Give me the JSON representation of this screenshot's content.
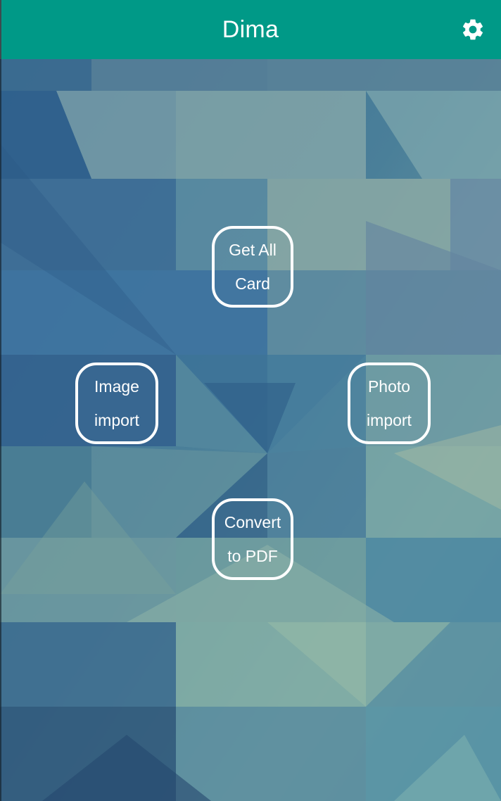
{
  "app": {
    "title": "Dima",
    "header_color": "#009987",
    "settings_icon": "gear-icon"
  },
  "actions": {
    "get_all_card": "Get All\nCard",
    "image_import": "Image\nimport",
    "photo_import": "Photo\nimport",
    "convert_to_pdf": "Convert\nto PDF"
  }
}
